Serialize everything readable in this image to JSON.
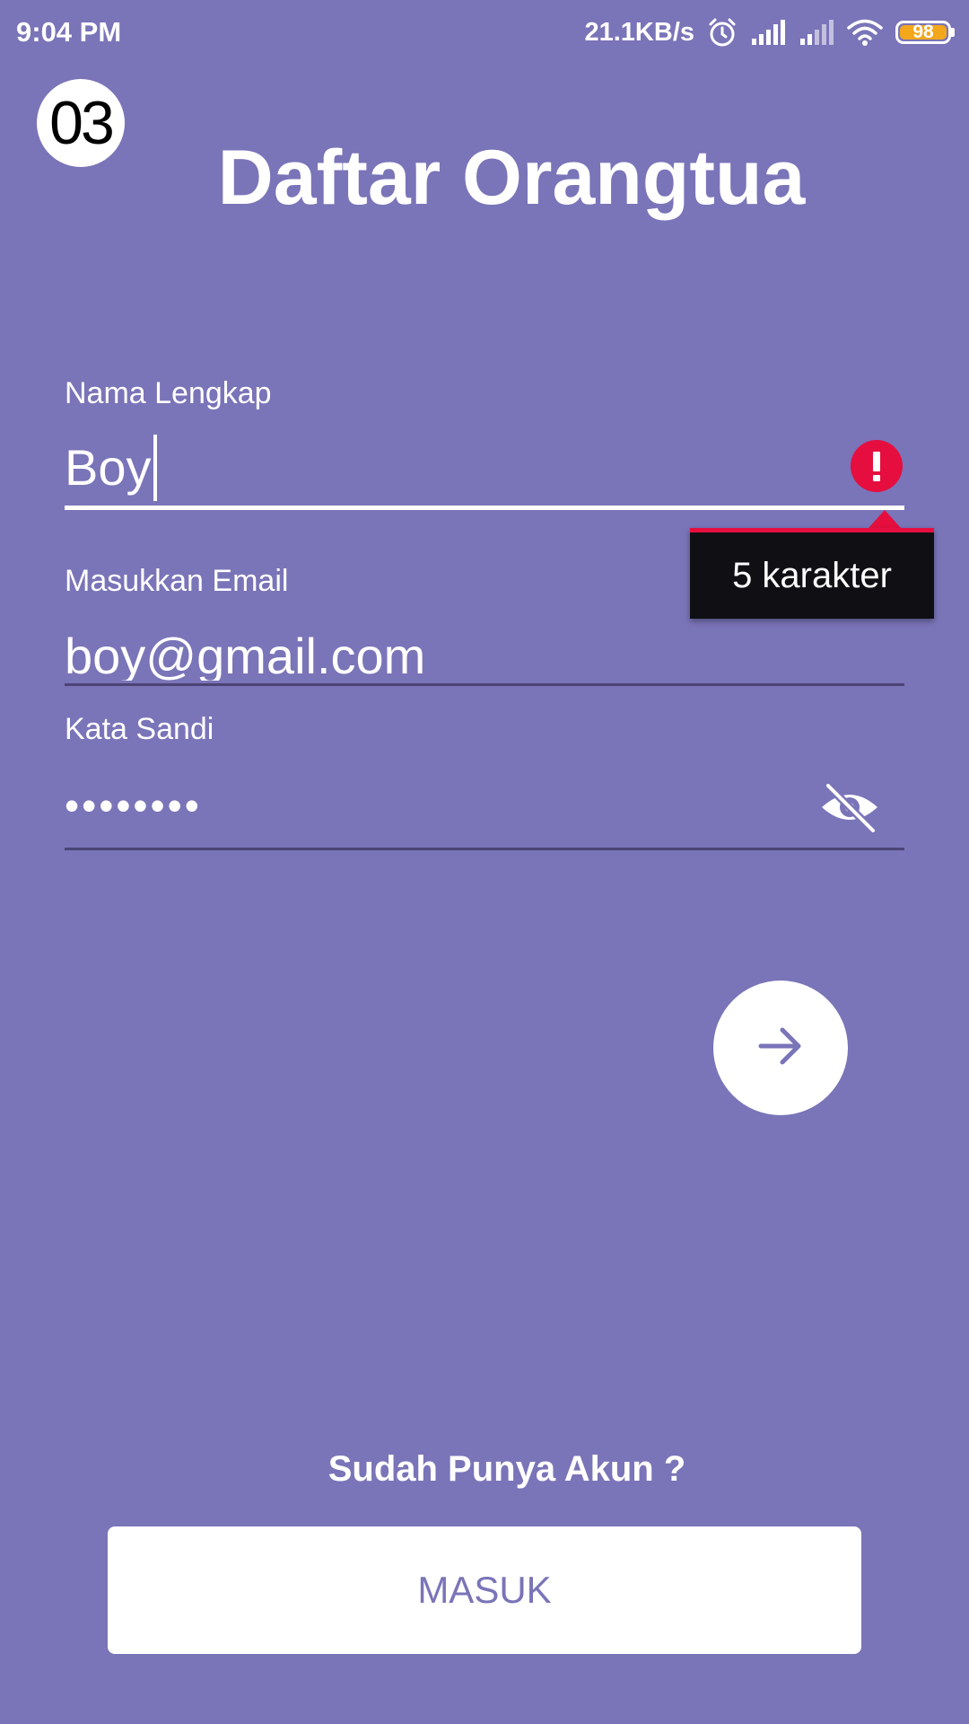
{
  "status_bar": {
    "time": "9:04 PM",
    "network_speed": "21.1KB/s",
    "battery_level": "98",
    "icons": [
      "alarm-icon",
      "signal-icon",
      "signal-icon",
      "wifi-icon",
      "battery-icon"
    ]
  },
  "step_badge": "03",
  "title": "Daftar Orangtua",
  "form": {
    "name_label": "Nama Lengkap",
    "name_value": "Boy",
    "name_error": "5 karakter",
    "email_label": "Masukkan Email",
    "email_value": "boy@gmail.com",
    "password_label": "Kata Sandi",
    "password_value": "••••••••"
  },
  "next_icon": "arrow-right-icon",
  "footer": {
    "have_account_text": "Sudah Punya Akun ?",
    "login_label": "MASUK"
  },
  "colors": {
    "background": "#7a74b8",
    "error": "#e60e3f",
    "tooltip_bg": "#0f0f14",
    "battery": "#f3a71b"
  }
}
